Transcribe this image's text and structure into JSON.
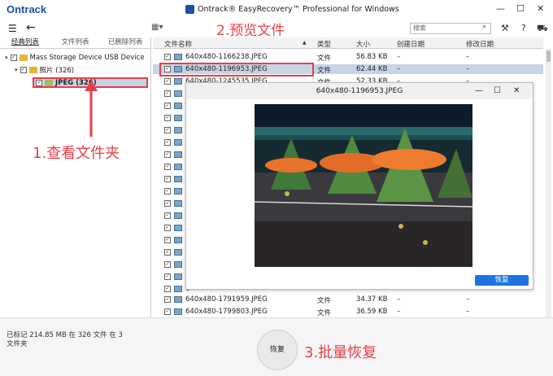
{
  "app": {
    "logo": "Ontrack",
    "title": "Ontrack® EasyRecovery™ Professional for Windows",
    "search_placeholder": "搜索"
  },
  "left_tabs": [
    "经典列表",
    "文件列表",
    "已删除列表"
  ],
  "tree": {
    "device": "Mass Storage Device USB Device",
    "folder": "照片 (326)",
    "subfolder": "JPEG (326)"
  },
  "columns": {
    "name": "文件名称",
    "type": "类型",
    "size": "大小",
    "created": "创建日期",
    "modified": "修改日期"
  },
  "files": [
    {
      "name": "640x480-1166238.JPEG",
      "type": "文件",
      "size": "56.83 KB",
      "created": "–",
      "modified": "–"
    },
    {
      "name": "640x480-1196953.JPEG",
      "type": "文件",
      "size": "62.44 KB",
      "created": "–",
      "modified": "–"
    },
    {
      "name": "640x480-1245535.JPEG",
      "type": "文件",
      "size": "52.33 KB",
      "created": "–",
      "modified": "–"
    },
    {
      "name": "640x480-1791959.JPEG",
      "type": "文件",
      "size": "34.37 KB",
      "created": "–",
      "modified": "–"
    },
    {
      "name": "640x480-1799803.JPEG",
      "type": "文件",
      "size": "36.59 KB",
      "created": "–",
      "modified": "–"
    }
  ],
  "hidden_row_prefix": "6·",
  "preview": {
    "title": "640x480-1196953.JPEG",
    "restore_label": "恢复"
  },
  "status": "已标记 214.85 MB 在 326 文件 在 3 文件夹",
  "restore_label": "恢复",
  "annotations": {
    "step1": "1.查看文件夹",
    "step2": "2.预览文件",
    "step3": "3.批量恢复"
  },
  "colors": {
    "annotation": "#e5404a",
    "brand": "#1b4fa3",
    "selected": "#c7d4e6",
    "button": "#1e73e0"
  }
}
